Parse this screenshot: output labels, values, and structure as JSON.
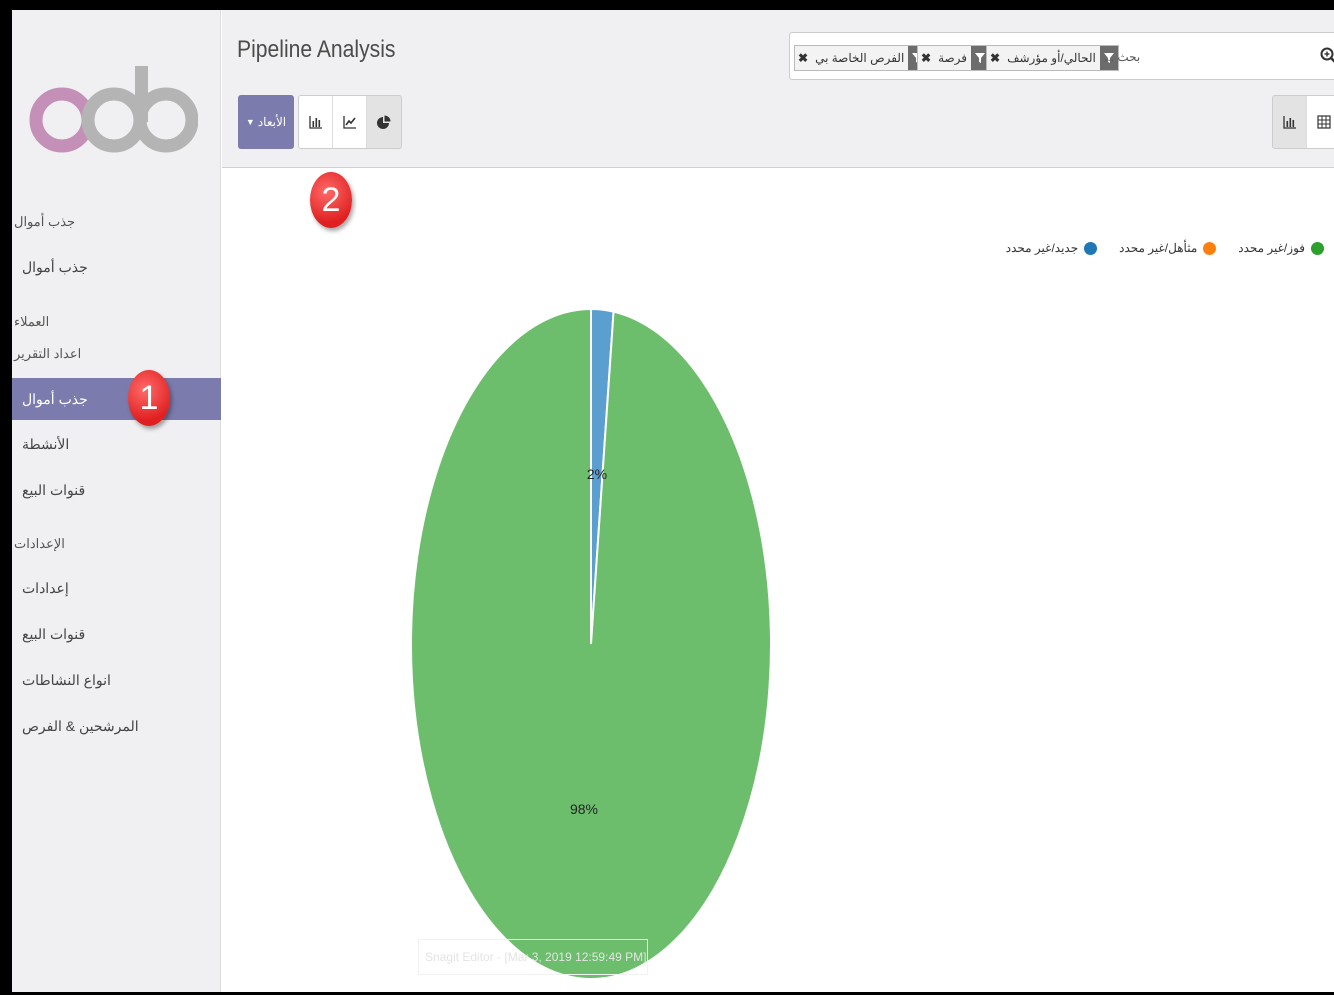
{
  "app": {
    "title": "Pipeline Analysis"
  },
  "sidebar": {
    "groups": [
      {
        "header": "جذب أموال",
        "items": [
          "جذب أموال"
        ]
      },
      {
        "header": "العملاء",
        "items": []
      },
      {
        "header": "اعداد التقرير",
        "items": [
          "جذب أموال",
          "الأنشطة",
          "قنوات البيع"
        ]
      },
      {
        "header": "الإعدادات",
        "items": [
          "إعدادات",
          "قنوات البيع",
          "انواع النشاطات",
          "المرشحين & الفرص"
        ]
      }
    ],
    "active_item": "جذب أموال"
  },
  "search": {
    "facets": [
      "الحالي/أو مؤرشف",
      "فرصة",
      "الفرص الخاصة بي"
    ],
    "placeholder": "بحث ..."
  },
  "toolbar": {
    "measures_label": "الأبعاد",
    "graph_modes": [
      "bar-chart-icon",
      "line-chart-icon",
      "pie-chart-icon"
    ],
    "active_mode": "pie",
    "views": [
      "graph-view-icon",
      "pivot-view-icon"
    ]
  },
  "annotations": {
    "step1": "1",
    "step2": "2"
  },
  "ghost_text": "Snagit Editor - [Mar 3, 2019 12:59:49 PM]",
  "chart_data": {
    "type": "pie",
    "slices": [
      {
        "label": "جديد/غير محدد",
        "value": 2,
        "label_text": "2%",
        "color": "#5b9fd0"
      },
      {
        "label": "فوز/غير محدد",
        "value": 98,
        "label_text": "98%",
        "color": "#6cbe6c"
      }
    ],
    "legend": [
      {
        "label": "فوز/غير محدد",
        "color": "#2ca02c"
      },
      {
        "label": "مثأهل/غير محدد",
        "color": "#ff7f0e"
      },
      {
        "label": "جديد/غير محدد",
        "color": "#1f77b4"
      }
    ],
    "legend_position": "top-right"
  }
}
